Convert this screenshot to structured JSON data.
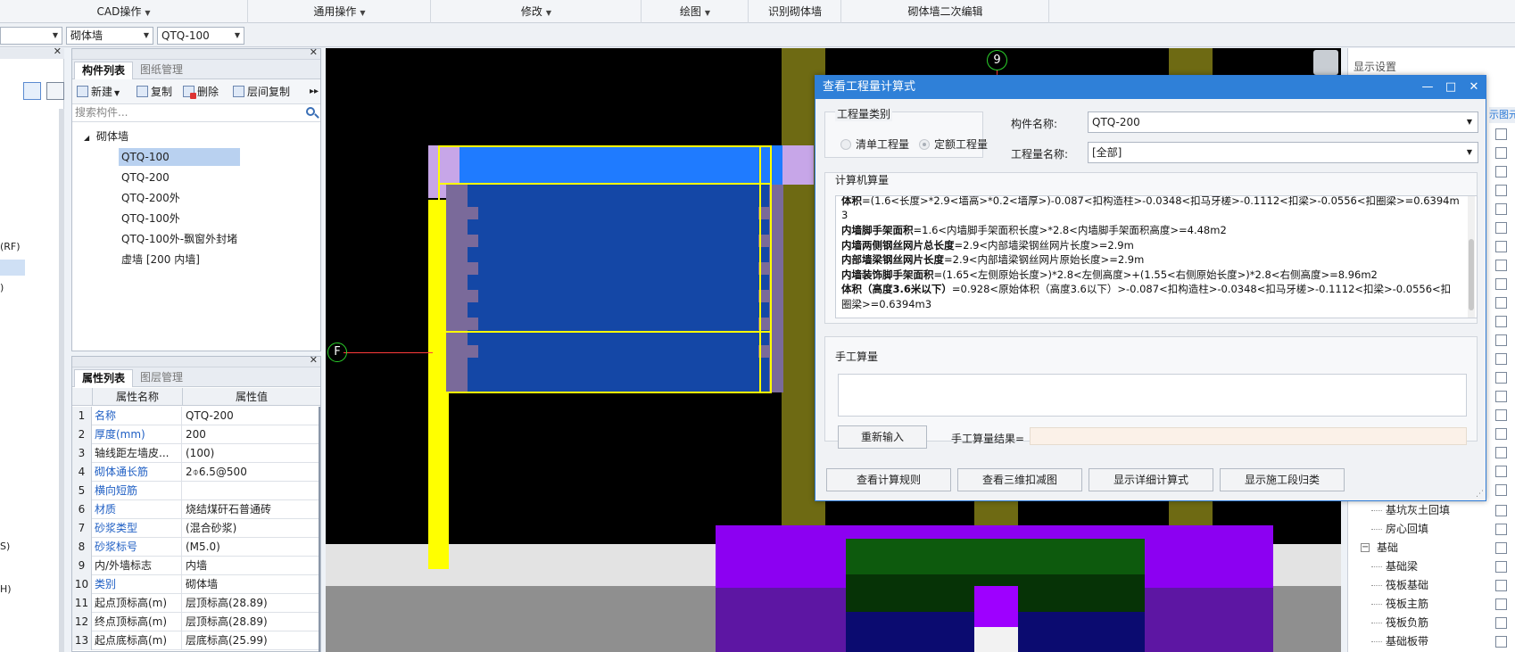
{
  "menubar": {
    "items": [
      {
        "label": "CAD操作",
        "arrow": "▼"
      },
      {
        "label": "通用操作",
        "arrow": "▼"
      },
      {
        "label": "修改",
        "arrow": "▼"
      },
      {
        "label": "绘图",
        "arrow": "▼"
      },
      {
        "label": "识别砌体墙",
        "arrow": ""
      },
      {
        "label": "砌体墙二次编辑",
        "arrow": ""
      }
    ]
  },
  "combos": {
    "first": "",
    "type": "砌体墙",
    "component": "QTQ-100"
  },
  "farleft": {
    "rf_label": "(RF)",
    "paren_label": ")",
    "s_label": "S)",
    "h_label": "H)"
  },
  "component_panel": {
    "tabs": [
      "构件列表",
      "图纸管理"
    ],
    "toolbar": [
      "新建",
      "复制",
      "删除",
      "层间复制"
    ],
    "search_placeholder": "搜索构件...",
    "tree_root": "砌体墙",
    "tree_items": [
      "QTQ-100",
      "QTQ-200",
      "QTQ-200外",
      "QTQ-100外",
      "QTQ-100外-飘窗外封堵",
      "虚墙 [200 内墙]"
    ],
    "selected": "QTQ-100"
  },
  "property_panel": {
    "tabs": [
      "属性列表",
      "图层管理"
    ],
    "headers": {
      "name": "属性名称",
      "value": "属性值"
    },
    "rows": [
      {
        "num": "1",
        "name": "名称",
        "value": "QTQ-200",
        "blue": true
      },
      {
        "num": "2",
        "name": "厚度(mm)",
        "value": "200",
        "blue": true
      },
      {
        "num": "3",
        "name": "轴线距左墙皮...",
        "value": "(100)",
        "blue": false
      },
      {
        "num": "4",
        "name": "砌体通长筋",
        "value": "2⌽6.5@500",
        "blue": true
      },
      {
        "num": "5",
        "name": "横向短筋",
        "value": "",
        "blue": true
      },
      {
        "num": "6",
        "name": "材质",
        "value": "烧结煤矸石普通砖",
        "blue": true
      },
      {
        "num": "7",
        "name": "砂浆类型",
        "value": "(混合砂浆)",
        "blue": true
      },
      {
        "num": "8",
        "name": "砂浆标号",
        "value": "(M5.0)",
        "blue": true
      },
      {
        "num": "9",
        "name": "内/外墙标志",
        "value": "内墙",
        "blue": false
      },
      {
        "num": "10",
        "name": "类别",
        "value": "砌体墙",
        "blue": true
      },
      {
        "num": "11",
        "name": "起点顶标高(m)",
        "value": "层顶标高(28.89)",
        "blue": false
      },
      {
        "num": "12",
        "name": "终点顶标高(m)",
        "value": "层顶标高(28.89)",
        "blue": false
      },
      {
        "num": "13",
        "name": "起点底标高(m)",
        "value": "层底标高(25.99)",
        "blue": false
      }
    ]
  },
  "canvas": {
    "axis_top": "9",
    "axis_left": "F"
  },
  "right_panel": {
    "title": "显示设置",
    "col_label": "示图元",
    "items": [
      {
        "label": "基坑灰土回填",
        "level": 2
      },
      {
        "label": "房心回填",
        "level": 2
      },
      {
        "label": "基础",
        "level": 1
      },
      {
        "label": "基础梁",
        "level": 2
      },
      {
        "label": "筏板基础",
        "level": 2
      },
      {
        "label": "筏板主筋",
        "level": 2
      },
      {
        "label": "筏板负筋",
        "level": 2
      },
      {
        "label": "基础板带",
        "level": 2
      }
    ],
    "expander": "−"
  },
  "dialog": {
    "title": "查看工程量计算式",
    "controls": [
      "—",
      "□",
      "✕"
    ],
    "qty_category_label": "工程量类别",
    "radio_list": "清单工程量",
    "radio_quota": "定额工程量",
    "component_name_label": "构件名称:",
    "component_name_value": "QTQ-200",
    "qty_name_label": "工程量名称:",
    "qty_name_value": "[全部]",
    "computer_calc_label": "计算机算量",
    "calc_lines": [
      {
        "bold": "体积",
        "text": "=(1.6<长度>*2.9<墙高>*0.2<墙厚>)-0.087<扣构造柱>-0.0348<扣马牙槎>-0.1112<扣梁>-0.0556<扣圈梁>=0.6394m"
      },
      {
        "bold": "",
        "text": "3"
      },
      {
        "bold": "内墙脚手架面积",
        "text": "=1.6<内墙脚手架面积长度>*2.8<内墙脚手架面积高度>=4.48m2"
      },
      {
        "bold": "内墙两侧钢丝网片总长度",
        "text": "=2.9<内部墙梁钢丝网片长度>=2.9m"
      },
      {
        "bold": "内部墙梁钢丝网片长度",
        "text": "=2.9<内部墙梁钢丝网片原始长度>=2.9m"
      },
      {
        "bold": "内墙装饰脚手架面积",
        "text": "=(1.65<左侧原始长度>)*2.8<左侧高度>+(1.55<右侧原始长度>)*2.8<右侧高度>=8.96m2"
      },
      {
        "bold": "体积（高度3.6米以下）",
        "text": "=0.928<原始体积（高度3.6以下）>-0.087<扣构造柱>-0.0348<扣马牙槎>-0.1112<扣梁>-0.0556<扣"
      },
      {
        "bold": "",
        "text": "圈梁>=0.6394m3"
      }
    ],
    "manual_calc_label": "手工算量",
    "reenter_button": "重新输入",
    "manual_result_label": "手工算量结果=",
    "bottom_buttons": [
      "查看计算规则",
      "查看三维扣减图",
      "显示详细计算式",
      "显示施工段归类"
    ]
  }
}
